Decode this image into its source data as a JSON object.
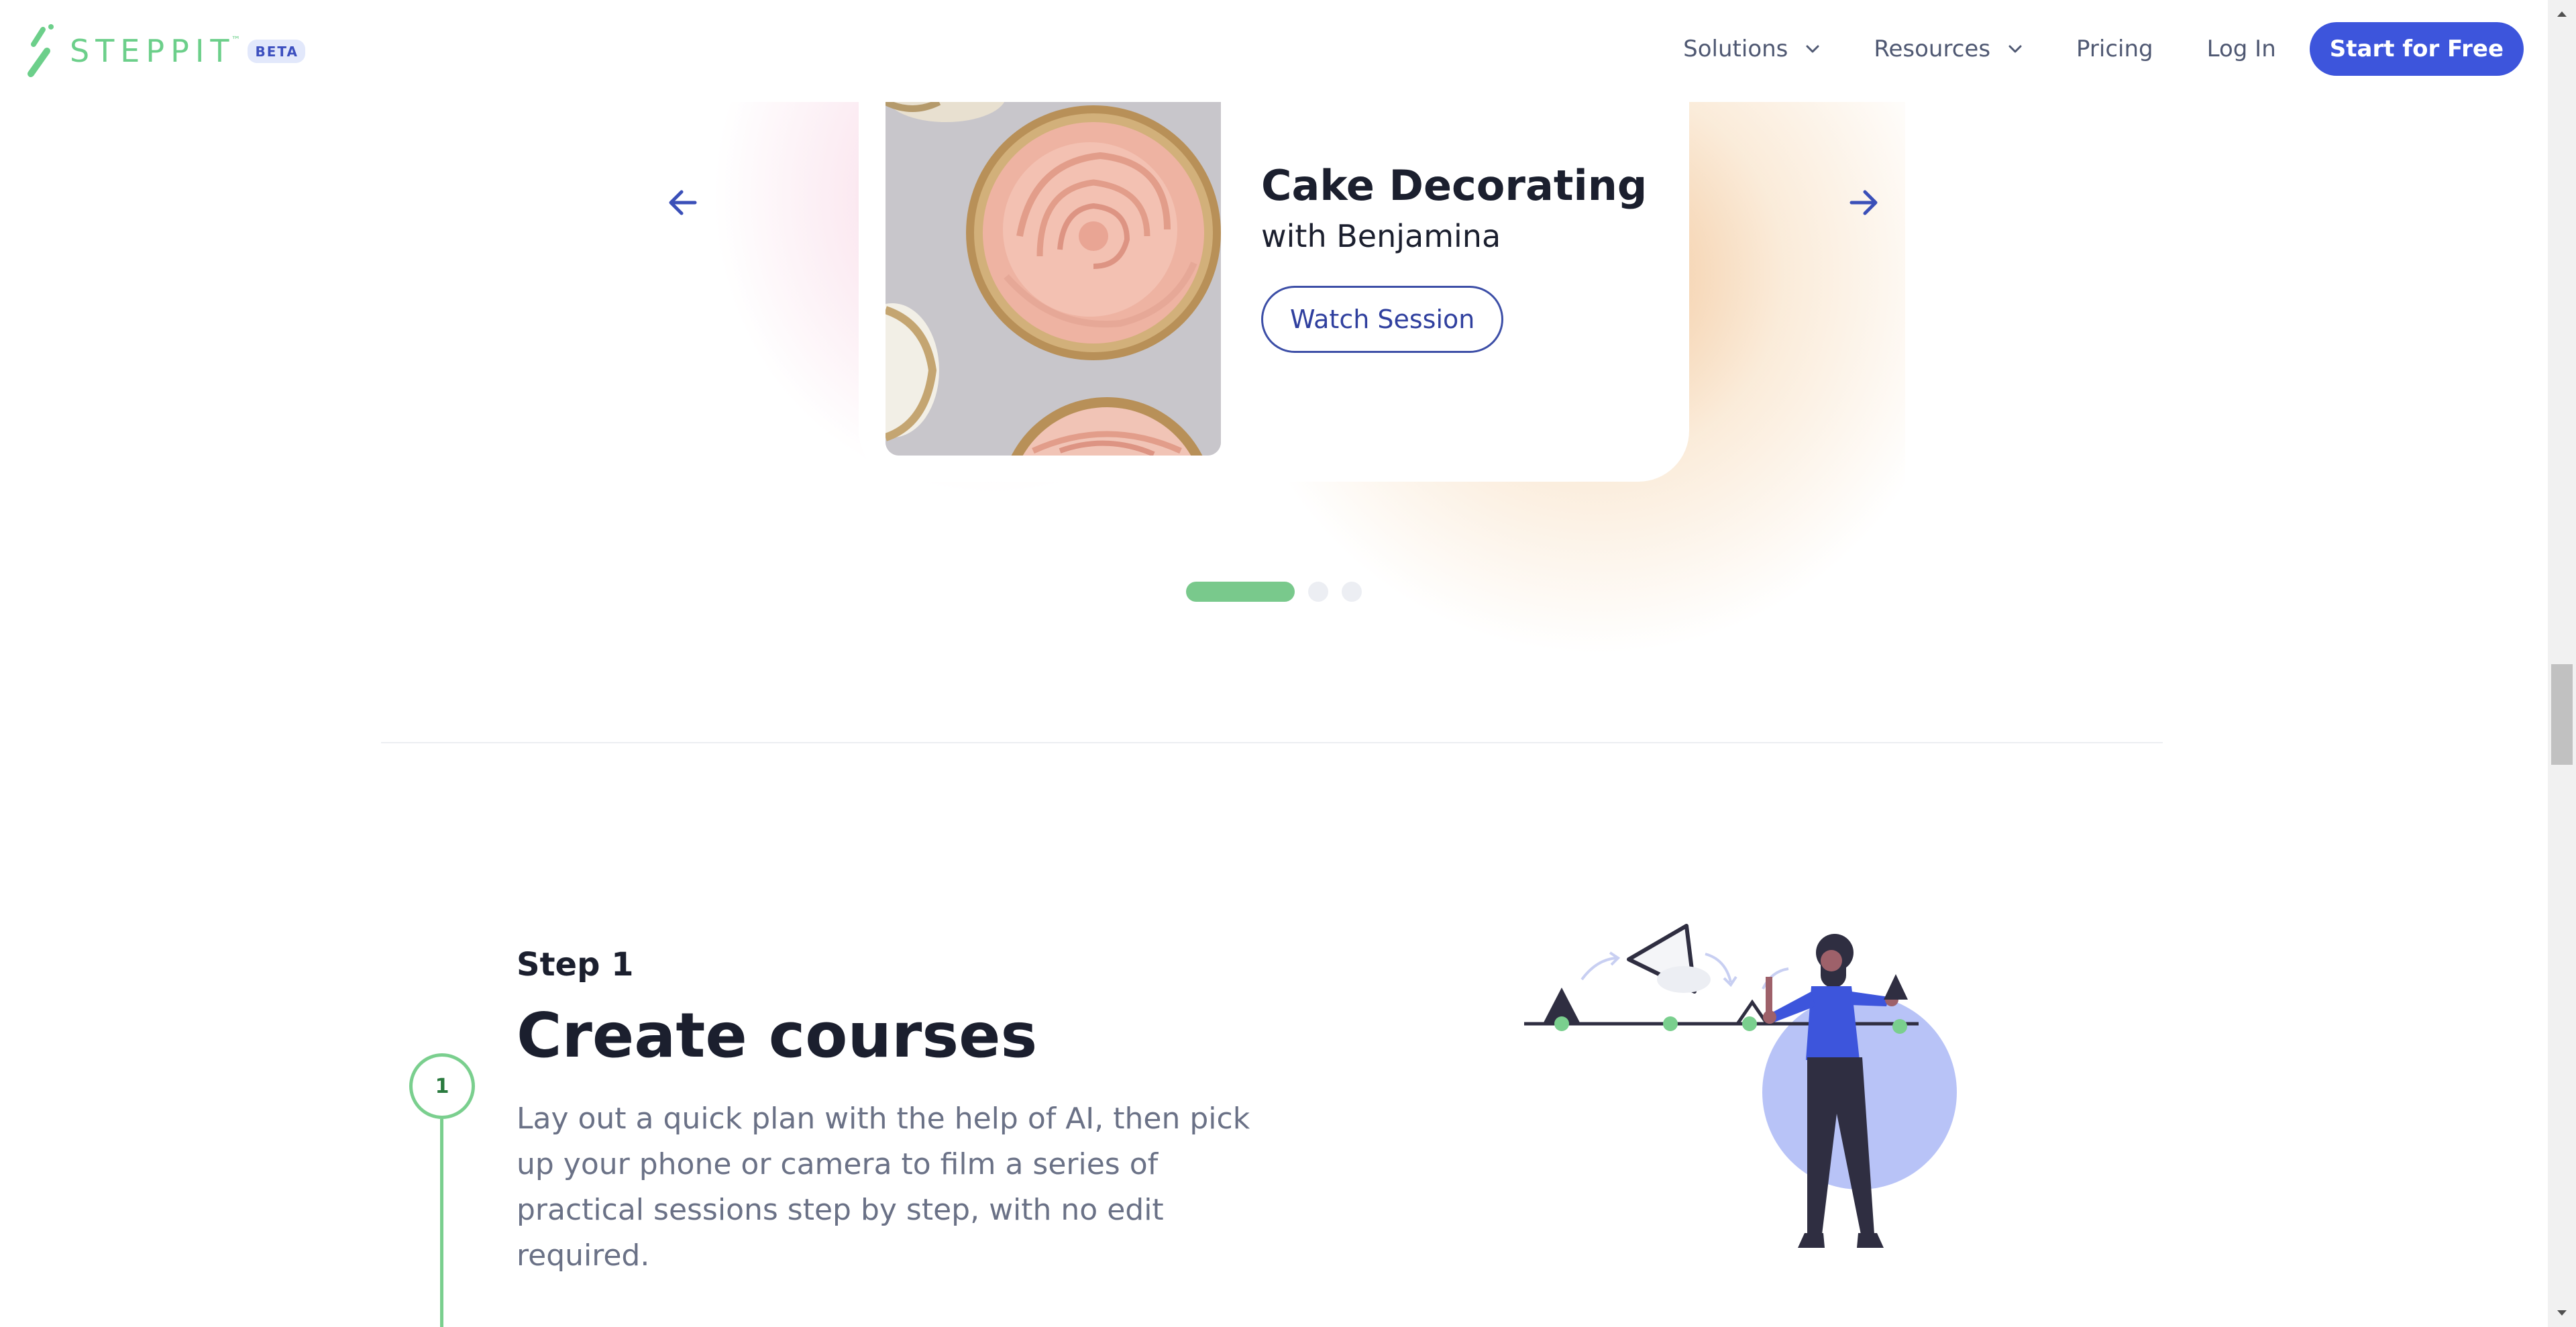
{
  "header": {
    "logo_text": "STEPPIT",
    "logo_tm": "™",
    "beta_badge": "BETA",
    "nav": {
      "solutions": "Solutions",
      "resources": "Resources",
      "pricing": "Pricing",
      "login": "Log In",
      "cta": "Start for Free"
    }
  },
  "carousel": {
    "title": "Cake Decorating",
    "subtitle": "with Benjamina",
    "button": "Watch Session",
    "slide_count": 3,
    "active_slide": 1
  },
  "step": {
    "number": "1",
    "label": "Step 1",
    "title": "Create courses",
    "description": "Lay out a quick plan with the help of AI, then pick up your phone or camera to film a series of practical sessions step by step, with no edit required."
  },
  "colors": {
    "brand_green": "#6ccf8a",
    "primary_blue": "#3d55dc",
    "dark_text": "#1b1f2e",
    "muted_text": "#6a7186"
  },
  "icons": [
    "steppit-logo-icon",
    "chevron-down-icon",
    "arrow-left-icon",
    "arrow-right-icon",
    "scroll-up-icon",
    "scroll-down-icon"
  ]
}
